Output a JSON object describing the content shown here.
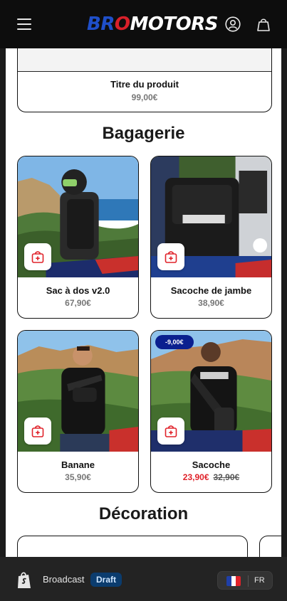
{
  "header": {
    "logo": {
      "part1": "BR",
      "part2": "O",
      "part3": "MOTORS"
    }
  },
  "top_product": {
    "name": "Titre du produit",
    "price": "99,00€"
  },
  "sections": {
    "bagagerie": {
      "title": "Bagagerie",
      "products": [
        {
          "name": "Sac à dos v2.0",
          "price": "67,90€"
        },
        {
          "name": "Sacoche de jambe",
          "price": "38,90€"
        },
        {
          "name": "Banane",
          "price": "35,90€"
        },
        {
          "name": "Sacoche",
          "badge": "-9,00€",
          "sale_price": "23,90€",
          "old_price": "32,90€"
        }
      ]
    },
    "decoration": {
      "title": "Décoration"
    }
  },
  "bottom_bar": {
    "name": "Broadcast",
    "status": "Draft",
    "language": "FR"
  },
  "colors": {
    "brand_blue": "#1f4fc9",
    "brand_red": "#d8202a",
    "sale_red": "#e0222a",
    "badge_blue": "#0a1f8f"
  }
}
